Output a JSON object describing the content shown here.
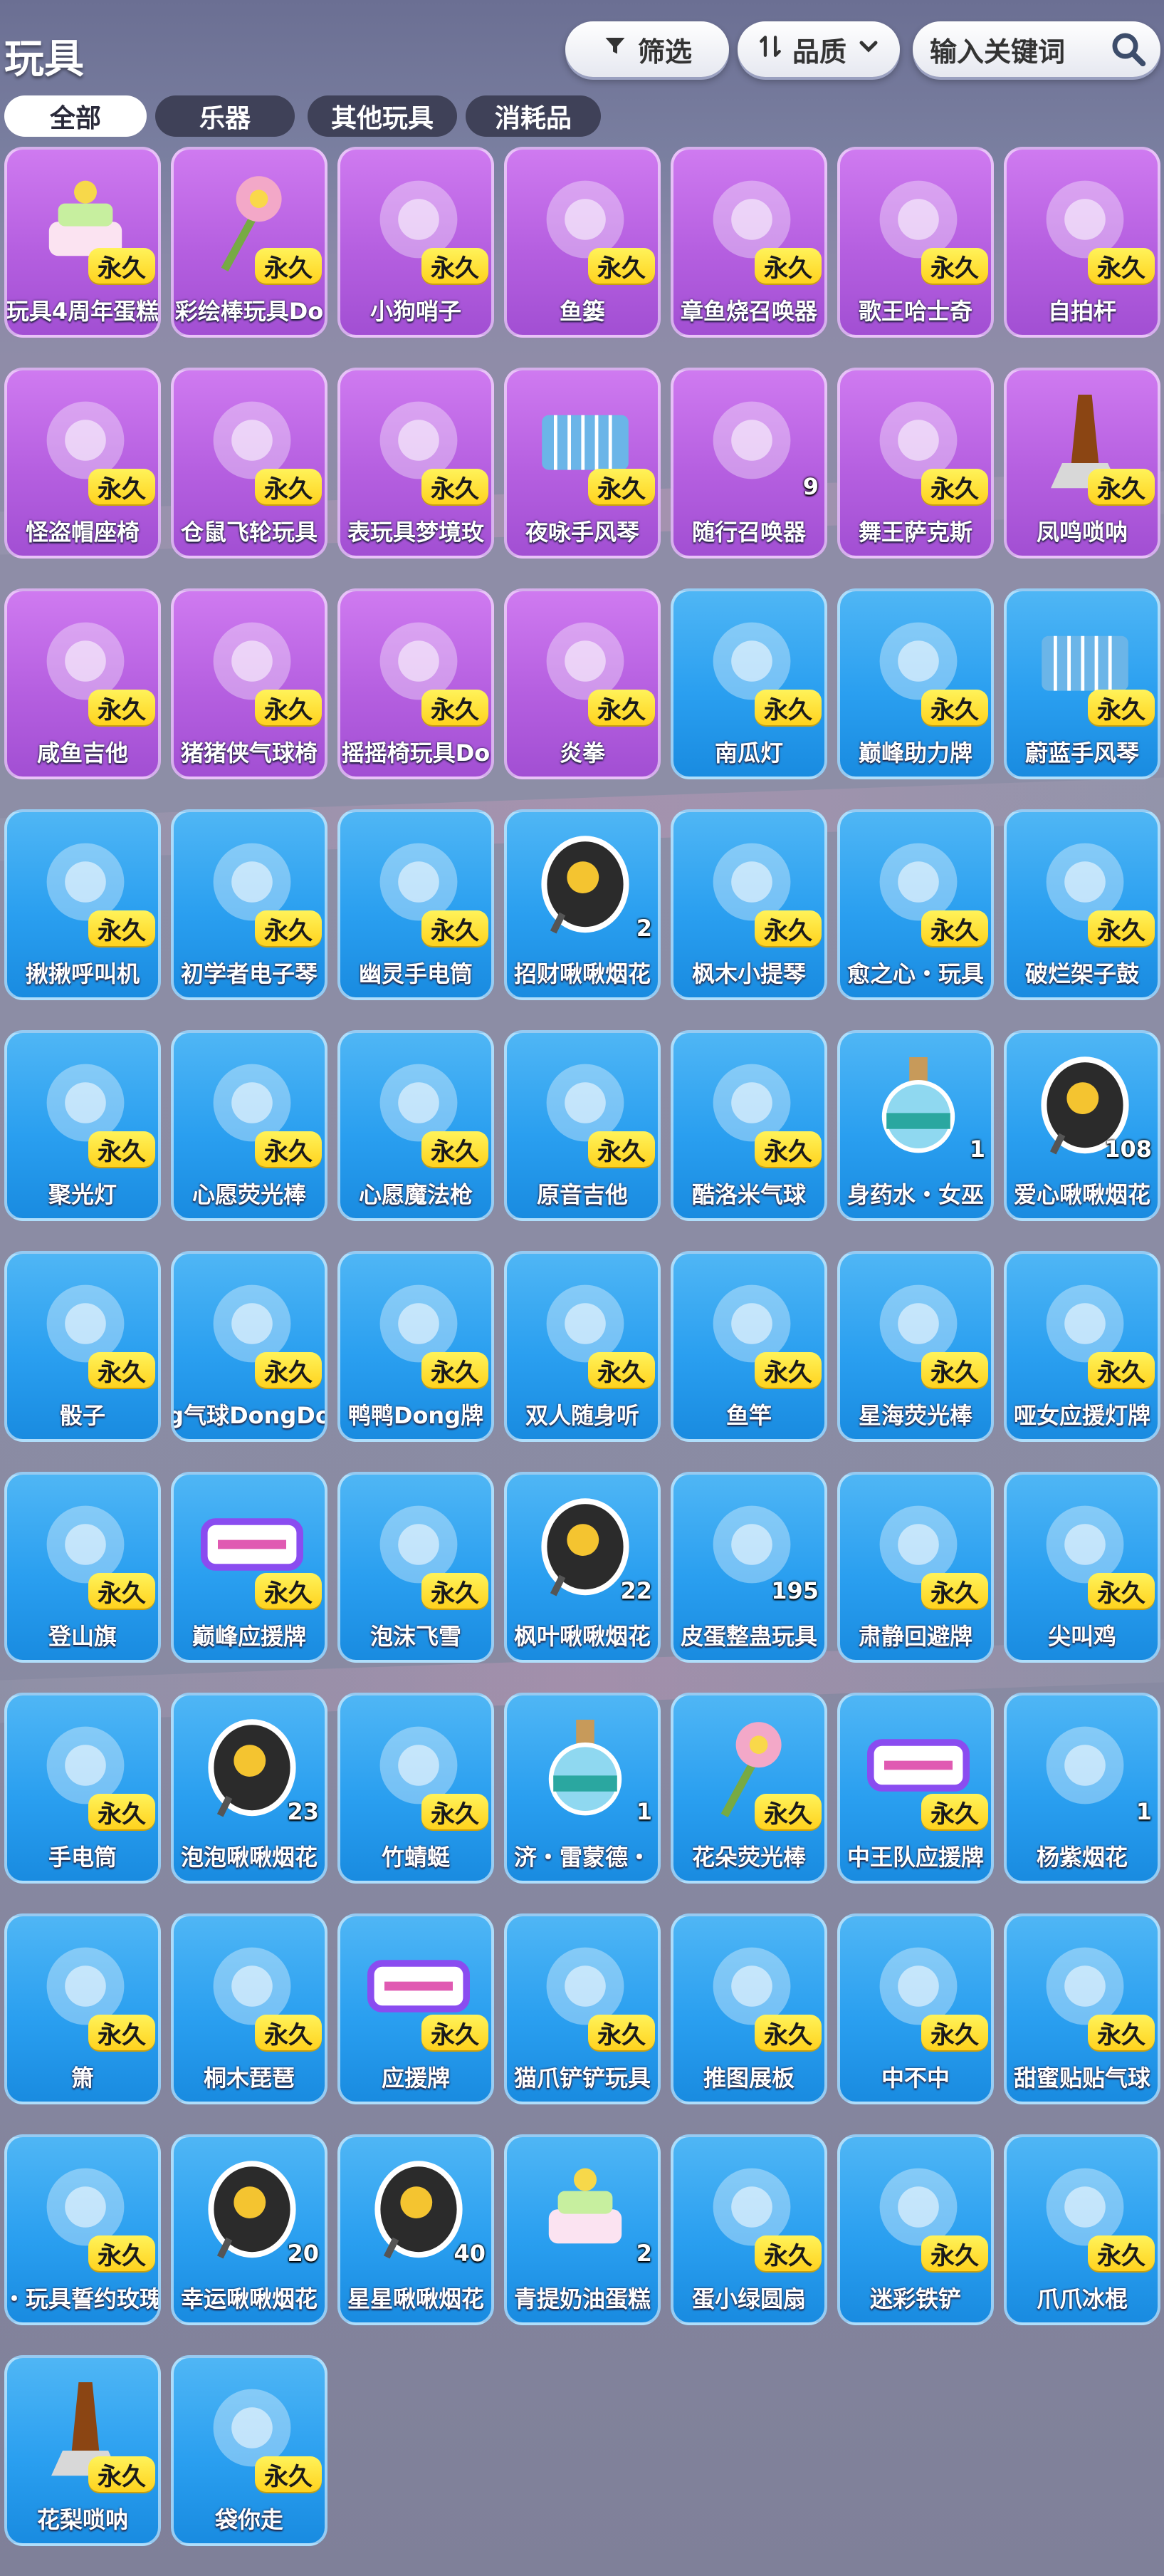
{
  "header": {
    "title": "玩具",
    "filter_label": "筛选",
    "quality_label": "品质",
    "search_placeholder": "输入关键词"
  },
  "tabs": [
    {
      "label": "全部",
      "active": true
    },
    {
      "label": "乐器",
      "active": false
    },
    {
      "label": "其他玩具",
      "active": false
    },
    {
      "label": "消耗品",
      "active": false
    }
  ],
  "colors": {
    "purple_card": "#b55fe0",
    "blue_card": "#2a9ff0",
    "badge": "#ffd21e"
  },
  "items": [
    {
      "name": "玩具4周年蛋糕",
      "badge": "永久",
      "color": "purple",
      "icon": "cake-icon"
    },
    {
      "name": "彩绘棒玩具Do",
      "badge": "永久",
      "color": "purple",
      "icon": "flower-wand-icon"
    },
    {
      "name": "小狗哨子",
      "badge": "永久",
      "color": "purple",
      "icon": "whistle-icon"
    },
    {
      "name": "鱼篓",
      "badge": "永久",
      "color": "purple",
      "icon": "bag-icon"
    },
    {
      "name": "章鱼烧召唤器",
      "badge": "永久",
      "color": "purple",
      "icon": "octopus-icon"
    },
    {
      "name": "歌王哈士奇",
      "badge": "永久",
      "color": "purple",
      "icon": "husky-icon"
    },
    {
      "name": "自拍杆",
      "badge": "永久",
      "color": "purple",
      "icon": "selfie-stick-icon"
    },
    {
      "name": "怪盗帽座椅",
      "badge": "永久",
      "color": "purple",
      "icon": "top-hat-icon"
    },
    {
      "name": "仓鼠飞轮玩具",
      "badge": "永久",
      "color": "purple",
      "icon": "ferris-wheel-icon"
    },
    {
      "name": "表玩具梦境玫",
      "badge": "永久",
      "color": "purple",
      "icon": "pocket-watch-icon"
    },
    {
      "name": "夜咏手风琴",
      "badge": "永久",
      "color": "purple",
      "icon": "accordion-icon"
    },
    {
      "name": "随行召唤器",
      "count": "9",
      "color": "purple",
      "icon": "robot-icon"
    },
    {
      "name": "舞王萨克斯",
      "badge": "永久",
      "color": "purple",
      "icon": "saxophone-icon"
    },
    {
      "name": "凤鸣唢呐",
      "badge": "永久",
      "color": "purple",
      "icon": "suona-icon"
    },
    {
      "name": "咸鱼吉他",
      "badge": "永久",
      "color": "purple",
      "icon": "fish-guitar-icon"
    },
    {
      "name": "猪猪侠气球椅",
      "badge": "永久",
      "color": "purple",
      "icon": "pig-balloon-icon"
    },
    {
      "name": "摇摇椅玩具Do",
      "badge": "永久",
      "color": "purple",
      "icon": "sheep-icon"
    },
    {
      "name": "炎拳",
      "badge": "永久",
      "color": "purple",
      "icon": "fire-fist-icon"
    },
    {
      "name": "南瓜灯",
      "badge": "永久",
      "color": "blue",
      "icon": "lantern-icon"
    },
    {
      "name": "巅峰助力牌",
      "badge": "永久",
      "color": "blue",
      "icon": "sign-board-icon"
    },
    {
      "name": "蔚蓝手风琴",
      "badge": "永久",
      "color": "blue",
      "icon": "accordion-icon"
    },
    {
      "name": "揪揪呼叫机",
      "badge": "永久",
      "color": "blue",
      "icon": "pager-icon"
    },
    {
      "name": "初学者电子琴",
      "badge": "永久",
      "color": "blue",
      "icon": "keyboard-icon"
    },
    {
      "name": "幽灵手电筒",
      "badge": "永久",
      "color": "blue",
      "icon": "ghost-flashlight-icon"
    },
    {
      "name": "招财啾啾烟花",
      "count": "2",
      "color": "blue",
      "icon": "firework-icon"
    },
    {
      "name": "枫木小提琴",
      "badge": "永久",
      "color": "blue",
      "icon": "violin-icon"
    },
    {
      "name": "愈之心・玩具",
      "badge": "永久",
      "color": "blue",
      "icon": "heart-icon"
    },
    {
      "name": "破烂架子鼓",
      "badge": "永久",
      "color": "blue",
      "icon": "drum-icon"
    },
    {
      "name": "聚光灯",
      "badge": "永久",
      "color": "blue",
      "icon": "spotlight-icon"
    },
    {
      "name": "心愿荧光棒",
      "badge": "永久",
      "color": "blue",
      "icon": "butterfly-wand-icon"
    },
    {
      "name": "心愿魔法枪",
      "badge": "永久",
      "color": "blue",
      "icon": "magic-gun-icon"
    },
    {
      "name": "原音吉他",
      "badge": "永久",
      "color": "blue",
      "icon": "guitar-icon"
    },
    {
      "name": "酷洛米气球",
      "badge": "永久",
      "color": "blue",
      "icon": "kuromi-balloon-icon"
    },
    {
      "name": "身药水・女巫",
      "count": "1",
      "color": "blue",
      "icon": "potion-icon"
    },
    {
      "name": "爱心啾啾烟花",
      "count": "108",
      "color": "blue",
      "icon": "firework-icon"
    },
    {
      "name": "骰子",
      "badge": "永久",
      "color": "blue",
      "icon": "dice-icon"
    },
    {
      "name": "g气球DongDo",
      "badge": "永久",
      "color": "blue",
      "icon": "sheep-balloon-icon"
    },
    {
      "name": "鸭鸭Dong牌",
      "badge": "永久",
      "color": "blue",
      "icon": "duck-sign-icon"
    },
    {
      "name": "双人随身听",
      "badge": "永久",
      "color": "blue",
      "icon": "player-icon"
    },
    {
      "name": "鱼竿",
      "badge": "永久",
      "color": "blue",
      "icon": "fishing-rod-icon"
    },
    {
      "name": "星海荧光棒",
      "badge": "永久",
      "color": "blue",
      "icon": "star-wand-icon"
    },
    {
      "name": "哑女应援灯牌",
      "badge": "永久",
      "color": "blue",
      "icon": "heart-sign-icon"
    },
    {
      "name": "登山旗",
      "badge": "永久",
      "color": "blue",
      "icon": "flag-icon"
    },
    {
      "name": "巅峰应援牌",
      "badge": "永久",
      "color": "blue",
      "icon": "cheer-sign-icon"
    },
    {
      "name": "泡沫飞雪",
      "badge": "永久",
      "color": "blue",
      "icon": "spray-can-icon"
    },
    {
      "name": "枫叶啾啾烟花",
      "count": "22",
      "color": "blue",
      "icon": "firework-icon"
    },
    {
      "name": "皮蛋整蛊玩具",
      "count": "195",
      "color": "blue",
      "icon": "prank-toy-icon"
    },
    {
      "name": "肃静回避牌",
      "badge": "永久",
      "color": "blue",
      "icon": "quiet-sign-icon"
    },
    {
      "name": "尖叫鸡",
      "badge": "永久",
      "color": "blue",
      "icon": "chicken-icon"
    },
    {
      "name": "手电筒",
      "badge": "永久",
      "color": "blue",
      "icon": "flashlight-icon"
    },
    {
      "name": "泡泡啾啾烟花",
      "count": "23",
      "color": "blue",
      "icon": "firework-icon"
    },
    {
      "name": "竹蜻蜓",
      "badge": "永久",
      "color": "blue",
      "icon": "propeller-icon"
    },
    {
      "name": "济・雷蒙德・",
      "count": "1",
      "color": "blue",
      "icon": "potion-icon"
    },
    {
      "name": "花朵荧光棒",
      "badge": "永久",
      "color": "blue",
      "icon": "flower-wand-icon"
    },
    {
      "name": "中王队应援牌",
      "badge": "永久",
      "color": "blue",
      "icon": "cheer-sign-icon"
    },
    {
      "name": "杨紫烟花",
      "count": "1",
      "color": "blue",
      "icon": "rocket-icon"
    },
    {
      "name": "箫",
      "badge": "永久",
      "color": "blue",
      "icon": "flute-icon"
    },
    {
      "name": "桐木琵琶",
      "badge": "永久",
      "color": "blue",
      "icon": "pipa-icon"
    },
    {
      "name": "应援牌",
      "badge": "永久",
      "color": "blue",
      "icon": "cheer-sign-icon"
    },
    {
      "name": "猫爪铲铲玩具",
      "badge": "永久",
      "color": "blue",
      "icon": "paw-wand-icon"
    },
    {
      "name": "推图展板",
      "badge": "永久",
      "color": "blue",
      "icon": "board-icon"
    },
    {
      "name": "中不中",
      "badge": "永久",
      "color": "blue",
      "icon": "zhong-sign-icon"
    },
    {
      "name": "甜蜜贴贴气球",
      "badge": "永久",
      "color": "blue",
      "icon": "bear-balloon-icon"
    },
    {
      "name": "・玩具誓约玫瑰",
      "badge": "永久",
      "color": "blue",
      "icon": "rose-icon"
    },
    {
      "name": "幸运啾啾烟花",
      "count": "20",
      "color": "blue",
      "icon": "firework-icon"
    },
    {
      "name": "星星啾啾烟花",
      "count": "40",
      "color": "blue",
      "icon": "firework-icon"
    },
    {
      "name": "青提奶油蛋糕",
      "count": "2",
      "color": "blue",
      "icon": "cake-icon"
    },
    {
      "name": "蛋小绿圆扇",
      "badge": "永久",
      "color": "blue",
      "icon": "fan-icon"
    },
    {
      "name": "迷彩铁铲",
      "badge": "永久",
      "color": "blue",
      "icon": "shovel-icon"
    },
    {
      "name": "爪爪冰棍",
      "badge": "永久",
      "color": "blue",
      "icon": "popsicle-icon"
    },
    {
      "name": "花梨唢呐",
      "badge": "永久",
      "color": "blue",
      "icon": "suona-icon"
    },
    {
      "name": "袋你走",
      "badge": "永久",
      "color": "blue",
      "icon": "sack-icon"
    }
  ]
}
